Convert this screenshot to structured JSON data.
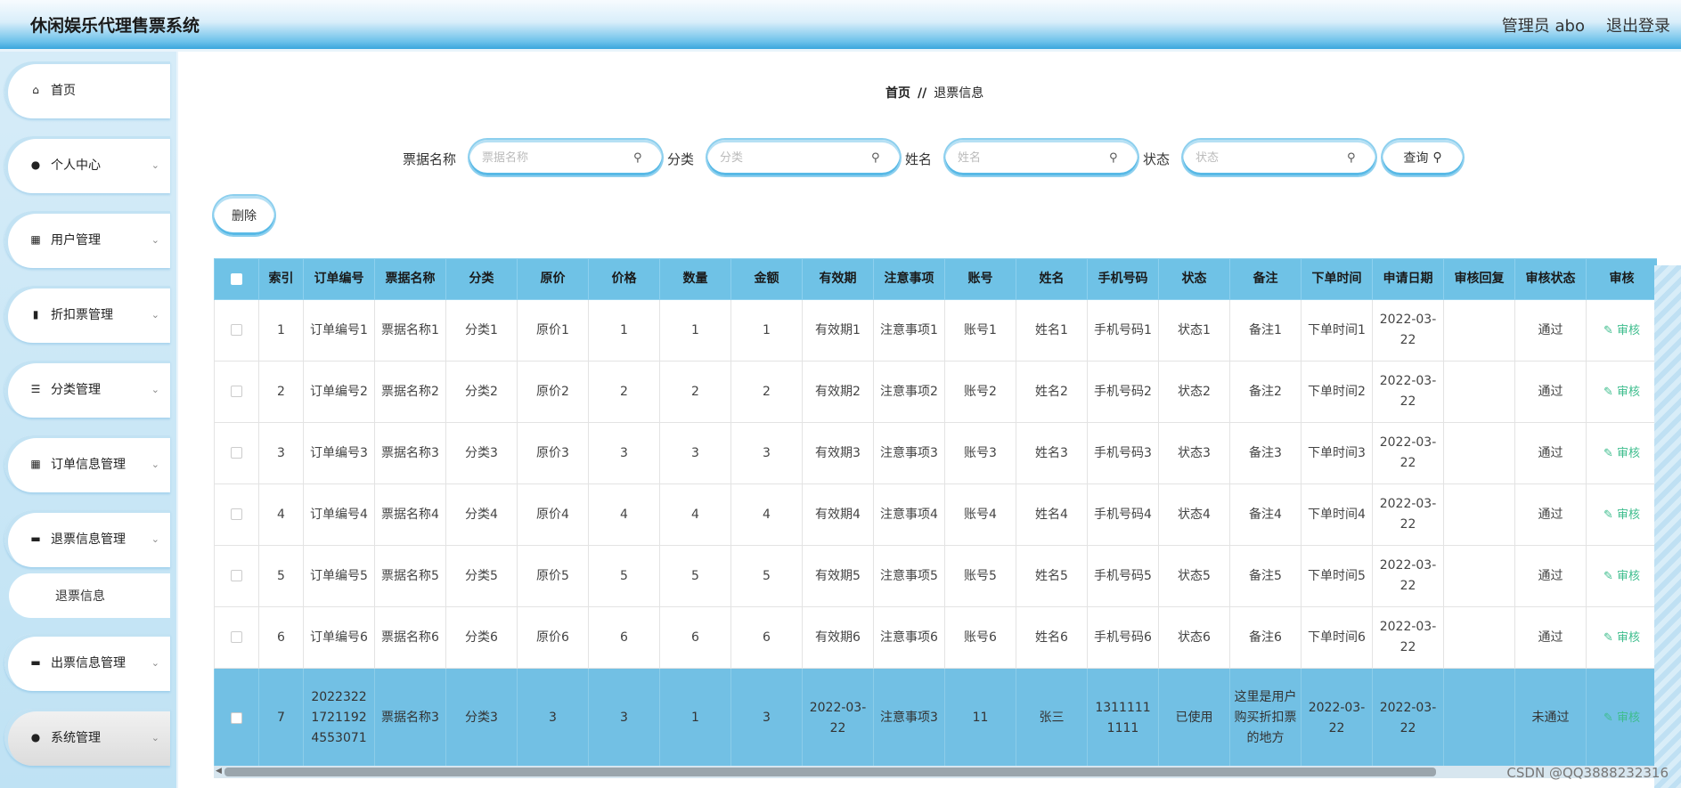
{
  "header": {
    "title": "休闲娱乐代理售票系统",
    "admin_label": "管理员 abo",
    "logout_label": "退出登录"
  },
  "sidebar": {
    "items": [
      {
        "label": "首页",
        "icon": "home-icon"
      },
      {
        "label": "个人中心",
        "icon": "user-icon"
      },
      {
        "label": "用户管理",
        "icon": "grid-icon"
      },
      {
        "label": "折扣票管理",
        "icon": "chart-icon"
      },
      {
        "label": "分类管理",
        "icon": "list-icon"
      },
      {
        "label": "订单信息管理",
        "icon": "grid-icon"
      },
      {
        "label": "退票信息管理",
        "icon": "monitor-icon"
      },
      {
        "label": "出票信息管理",
        "icon": "monitor-icon"
      },
      {
        "label": "系统管理",
        "icon": "user-icon"
      }
    ],
    "submenu_label": "退票信息"
  },
  "breadcrumb": {
    "home": "首页",
    "separator": "//",
    "current": "退票信息"
  },
  "search": {
    "fields": [
      {
        "label": "票据名称",
        "placeholder": "票据名称"
      },
      {
        "label": "分类",
        "placeholder": "分类"
      },
      {
        "label": "姓名",
        "placeholder": "姓名"
      },
      {
        "label": "状态",
        "placeholder": "状态"
      }
    ],
    "query_label": "查询"
  },
  "toolbar": {
    "delete_label": "删除"
  },
  "table": {
    "headers": [
      "索引",
      "订单编号",
      "票据名称",
      "分类",
      "原价",
      "价格",
      "数量",
      "金额",
      "有效期",
      "注意事项",
      "账号",
      "姓名",
      "手机号码",
      "状态",
      "备注",
      "下单时间",
      "申请日期",
      "审核回复",
      "审核状态",
      "审核"
    ],
    "audit_action": "审核",
    "rows": [
      [
        "1",
        "订单编号1",
        "票据名称1",
        "分类1",
        "原价1",
        "1",
        "1",
        "1",
        "有效期1",
        "注意事项1",
        "账号1",
        "姓名1",
        "手机号码1",
        "状态1",
        "备注1",
        "下单时间1",
        "2022-03-22",
        "",
        "通过"
      ],
      [
        "2",
        "订单编号2",
        "票据名称2",
        "分类2",
        "原价2",
        "2",
        "2",
        "2",
        "有效期2",
        "注意事项2",
        "账号2",
        "姓名2",
        "手机号码2",
        "状态2",
        "备注2",
        "下单时间2",
        "2022-03-22",
        "",
        "通过"
      ],
      [
        "3",
        "订单编号3",
        "票据名称3",
        "分类3",
        "原价3",
        "3",
        "3",
        "3",
        "有效期3",
        "注意事项3",
        "账号3",
        "姓名3",
        "手机号码3",
        "状态3",
        "备注3",
        "下单时间3",
        "2022-03-22",
        "",
        "通过"
      ],
      [
        "4",
        "订单编号4",
        "票据名称4",
        "分类4",
        "原价4",
        "4",
        "4",
        "4",
        "有效期4",
        "注意事项4",
        "账号4",
        "姓名4",
        "手机号码4",
        "状态4",
        "备注4",
        "下单时间4",
        "2022-03-22",
        "",
        "通过"
      ],
      [
        "5",
        "订单编号5",
        "票据名称5",
        "分类5",
        "原价5",
        "5",
        "5",
        "5",
        "有效期5",
        "注意事项5",
        "账号5",
        "姓名5",
        "手机号码5",
        "状态5",
        "备注5",
        "下单时间5",
        "2022-03-22",
        "",
        "通过"
      ],
      [
        "6",
        "订单编号6",
        "票据名称6",
        "分类6",
        "原价6",
        "6",
        "6",
        "6",
        "有效期6",
        "注意事项6",
        "账号6",
        "姓名6",
        "手机号码6",
        "状态6",
        "备注6",
        "下单时间6",
        "2022-03-22",
        "",
        "通过"
      ],
      [
        "7",
        "20223221721192 4553071",
        "票据名称3",
        "分类3",
        "3",
        "3",
        "1",
        "3",
        "2022-03-22",
        "注意事项3",
        "11",
        "张三",
        "13111111111",
        "已使用",
        "这里是用户购买折扣票的地方",
        "2022-03-22",
        "2022-03-22",
        "",
        "未通过"
      ]
    ]
  },
  "watermark": "CSDN @QQ3888232316",
  "colors": {
    "header_blue": "#3aa6dd",
    "table_header": "#6fc2e6",
    "audit_green": "#3dbd8d"
  }
}
